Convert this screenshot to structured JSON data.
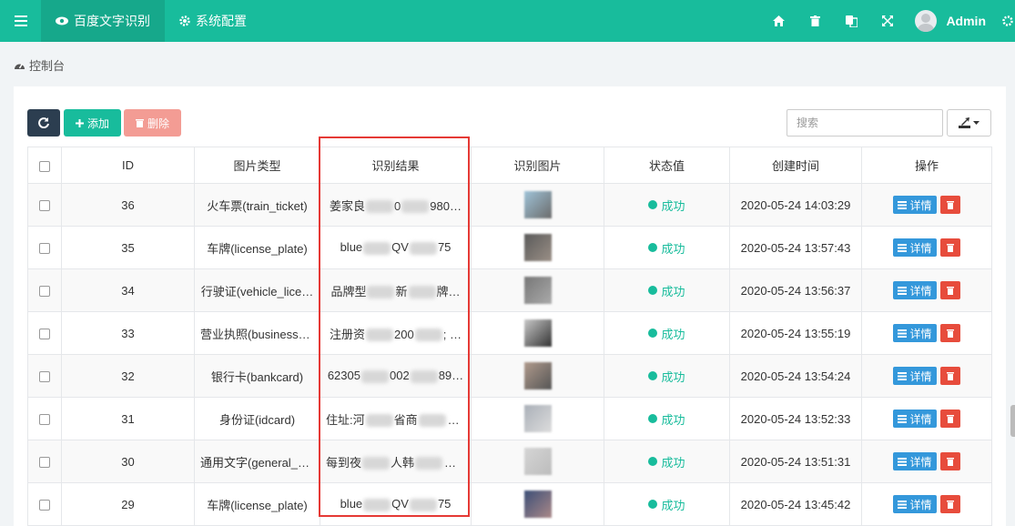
{
  "navbar": {
    "tabs": [
      {
        "label": "百度文字识别",
        "icon": "eye-icon",
        "active": true
      },
      {
        "label": "系统配置",
        "icon": "gear-icon",
        "active": false
      }
    ],
    "user": "Admin"
  },
  "breadcrumb": {
    "label": "控制台"
  },
  "toolbar": {
    "add_label": "添加",
    "delete_label": "删除",
    "search_placeholder": "搜索"
  },
  "table": {
    "headers": [
      "ID",
      "图片类型",
      "识别结果",
      "识别图片",
      "状态值",
      "创建时间",
      "操作"
    ],
    "rows": [
      {
        "id": "36",
        "type": "火车票(train_ticket)",
        "result_a": "姜家良",
        "result_b": "0",
        "result_c": "980…",
        "status": "成功",
        "time": "2020-05-24 14:03:29"
      },
      {
        "id": "35",
        "type": "车牌(license_plate)",
        "result_a": "blue",
        "result_b": "QV",
        "result_c": "75",
        "status": "成功",
        "time": "2020-05-24 13:57:43"
      },
      {
        "id": "34",
        "type": "行驶证(vehicle_lice…",
        "result_a": "品牌型",
        "result_b": "新",
        "result_c": "牌…",
        "status": "成功",
        "time": "2020-05-24 13:56:37"
      },
      {
        "id": "33",
        "type": "营业执照(business_…",
        "result_a": "注册资",
        "result_b": "200",
        "result_c": "; …",
        "status": "成功",
        "time": "2020-05-24 13:55:19"
      },
      {
        "id": "32",
        "type": "银行卡(bankcard)",
        "result_a": "62305",
        "result_b": "002",
        "result_c": "89…",
        "status": "成功",
        "time": "2020-05-24 13:54:24"
      },
      {
        "id": "31",
        "type": "身份证(idcard)",
        "result_a": "住址:河",
        "result_b": "省商",
        "result_c": "县…",
        "status": "成功",
        "time": "2020-05-24 13:52:33"
      },
      {
        "id": "30",
        "type": "通用文字(general_b…",
        "result_a": "每到夜",
        "result_b": "人韩",
        "result_c": "寸…",
        "status": "成功",
        "time": "2020-05-24 13:51:31"
      },
      {
        "id": "29",
        "type": "车牌(license_plate)",
        "result_a": "blue",
        "result_b": "QV",
        "result_c": "75",
        "status": "成功",
        "time": "2020-05-24 13:45:42"
      }
    ],
    "detail_label": "详情"
  },
  "colors": {
    "primary": "#18bc9c",
    "dark": "#2c3e50",
    "danger": "#e74c3c",
    "info": "#3498db",
    "highlight": "#e53935"
  }
}
